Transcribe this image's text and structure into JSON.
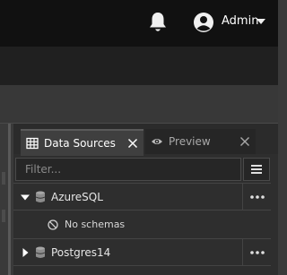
{
  "header": {
    "user_name": "Admin",
    "icons": [
      "bell-icon",
      "user-circle-icon",
      "caret-down-icon"
    ]
  },
  "tabs": [
    {
      "label": "Data Sources",
      "icon": "table-icon",
      "active": true
    },
    {
      "label": "Preview",
      "icon": "eye-icon",
      "active": false
    }
  ],
  "filter": {
    "placeholder": "Filter...",
    "value": ""
  },
  "sources": [
    {
      "name": "AzureSQL",
      "expanded": true
    },
    {
      "name": "Postgres14",
      "expanded": false
    }
  ],
  "empty_state": {
    "label": "No schemas",
    "icon": "ban-icon"
  },
  "colors": {
    "topbar": "#111111",
    "navbar": "#202020",
    "panel": "#2e2e2e",
    "active_tab": "#3f3f3f"
  }
}
